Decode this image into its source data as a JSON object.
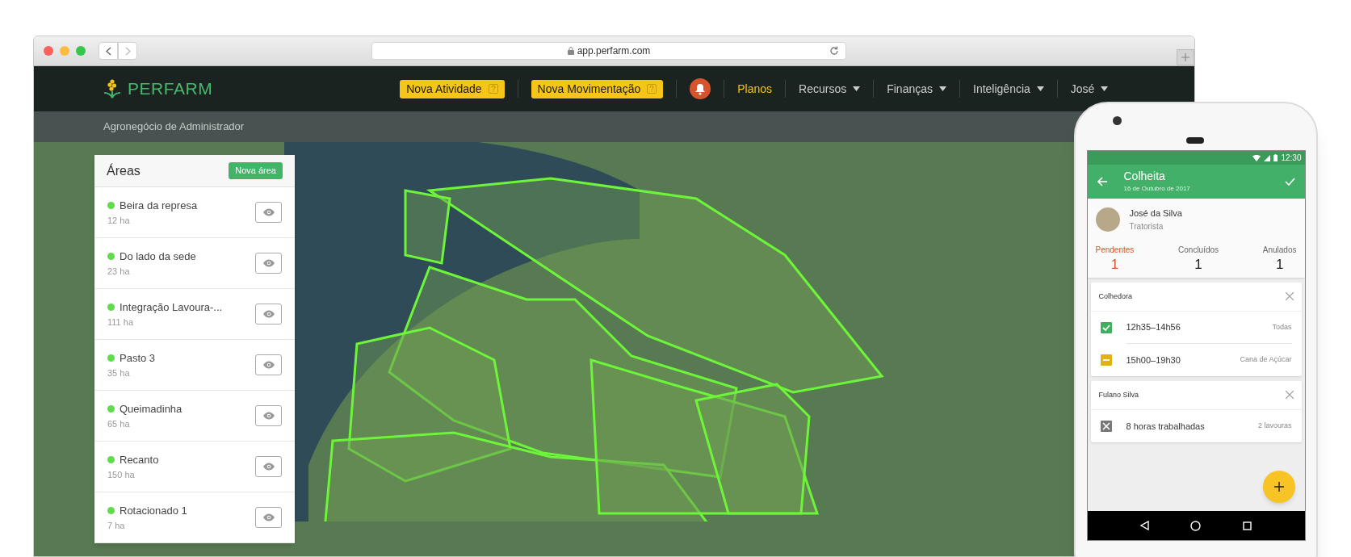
{
  "browser": {
    "url": "app.perfarm.com"
  },
  "navbar": {
    "logo": "PERFARM",
    "actions": [
      {
        "label": "Nova Atividade"
      },
      {
        "label": "Nova Movimentação"
      }
    ],
    "menu": [
      {
        "label": "Planos",
        "selected": true,
        "dropdown": false
      },
      {
        "label": "Recursos",
        "selected": false,
        "dropdown": true
      },
      {
        "label": "Finanças",
        "selected": false,
        "dropdown": true
      },
      {
        "label": "Inteligência",
        "selected": false,
        "dropdown": true
      },
      {
        "label": "José",
        "selected": false,
        "dropdown": true
      }
    ]
  },
  "subbar": {
    "title": "Agronegócio de Administrador"
  },
  "areas_panel": {
    "title": "Áreas",
    "new_button": "Nova área",
    "items": [
      {
        "name": "Beira da represa",
        "size": "12 ha"
      },
      {
        "name": "Do lado da sede",
        "size": "23 ha"
      },
      {
        "name": "Integração Lavoura-...",
        "size": "111 ha"
      },
      {
        "name": "Pasto 3",
        "size": "35 ha"
      },
      {
        "name": "Queimadinha",
        "size": "65 ha"
      },
      {
        "name": "Recanto",
        "size": "150 ha"
      },
      {
        "name": "Rotacionado 1",
        "size": "7 ha"
      }
    ]
  },
  "phone": {
    "status_time": "12:30",
    "title": "Colheita",
    "subtitle": "16 de Outubro de 2017",
    "user": {
      "name": "José da Silva",
      "role": "Tratorista"
    },
    "tabs": [
      {
        "label": "Pendentes",
        "count": "1",
        "selected": true
      },
      {
        "label": "Concluídos",
        "count": "1",
        "selected": false
      },
      {
        "label": "Anulados",
        "count": "1",
        "selected": false
      }
    ],
    "groups": [
      {
        "title": "Colhedora",
        "entries": [
          {
            "kind": "done",
            "text": "12h35–14h56",
            "scope": "Todas"
          },
          {
            "kind": "partial",
            "text": "15h00–19h30",
            "scope": "Cana de Açúcar"
          }
        ]
      },
      {
        "title": "Fulano Silva",
        "entries": [
          {
            "kind": "cancelled",
            "text": "8 horas trabalhadas",
            "scope": "2 lavouras"
          }
        ]
      }
    ]
  }
}
